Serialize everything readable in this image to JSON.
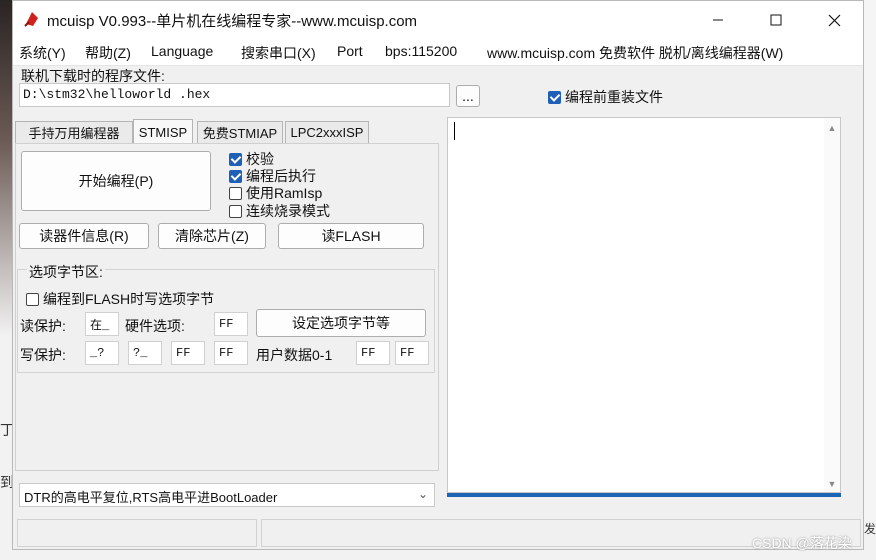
{
  "window": {
    "title": "mcuisp V0.993--单片机在线编程专家--www.mcuisp.com",
    "minimize_icon": "minimize-icon",
    "maximize_icon": "maximize-icon",
    "close_icon": "close-icon"
  },
  "menu": {
    "items": [
      "系统(Y)",
      "帮助(Z)",
      "Language",
      "搜索串口(X)",
      "Port",
      "bps:115200",
      "www.mcuisp.com 免费软件 脱机/离线编程器(W)"
    ]
  },
  "file": {
    "label": "联机下载时的程序文件:",
    "path": "D:\\stm32\\helloworld .hex",
    "browse": "...",
    "reload_label": "编程前重装文件",
    "reload_checked": true
  },
  "tabs": [
    "手持万用编程器",
    "STMISP",
    "免费STMIAP",
    "LPC2xxxISP"
  ],
  "actions": {
    "start": "开始编程(P)",
    "read_info": "读器件信息(R)",
    "erase": "清除芯片(Z)",
    "read_flash": "读FLASH"
  },
  "options": [
    {
      "label": "校验",
      "checked": true
    },
    {
      "label": "编程后执行",
      "checked": true
    },
    {
      "label": "使用RamIsp",
      "checked": false
    },
    {
      "label": "连续烧录模式",
      "checked": false
    }
  ],
  "option_bytes": {
    "title": "选项字节区:",
    "write_flash_label": "编程到FLASH时写选项字节",
    "write_flash_checked": false,
    "read_protect_label": "读保护:",
    "read_protect_value": "在_",
    "hw_label": "硬件选项:",
    "hw_value": "FF",
    "set_button": "设定选项字节等",
    "write_protect_label": "写保护:",
    "write_protect_values": [
      "_?",
      "?_",
      "FF",
      "FF"
    ],
    "user_data_label": "用户数据0-1",
    "user_data_values": [
      "FF",
      "FF"
    ]
  },
  "boot": {
    "selected": "DTR的高电平复位,RTS高电平进BootLoader"
  },
  "background": {
    "fragments": [
      "丁",
      "到",
      "发"
    ]
  },
  "watermark": "CSDN @落花染",
  "colors": {
    "accent": "#1f5fb5",
    "progress": "#1c64b4",
    "app_icon": "#d0211c"
  }
}
